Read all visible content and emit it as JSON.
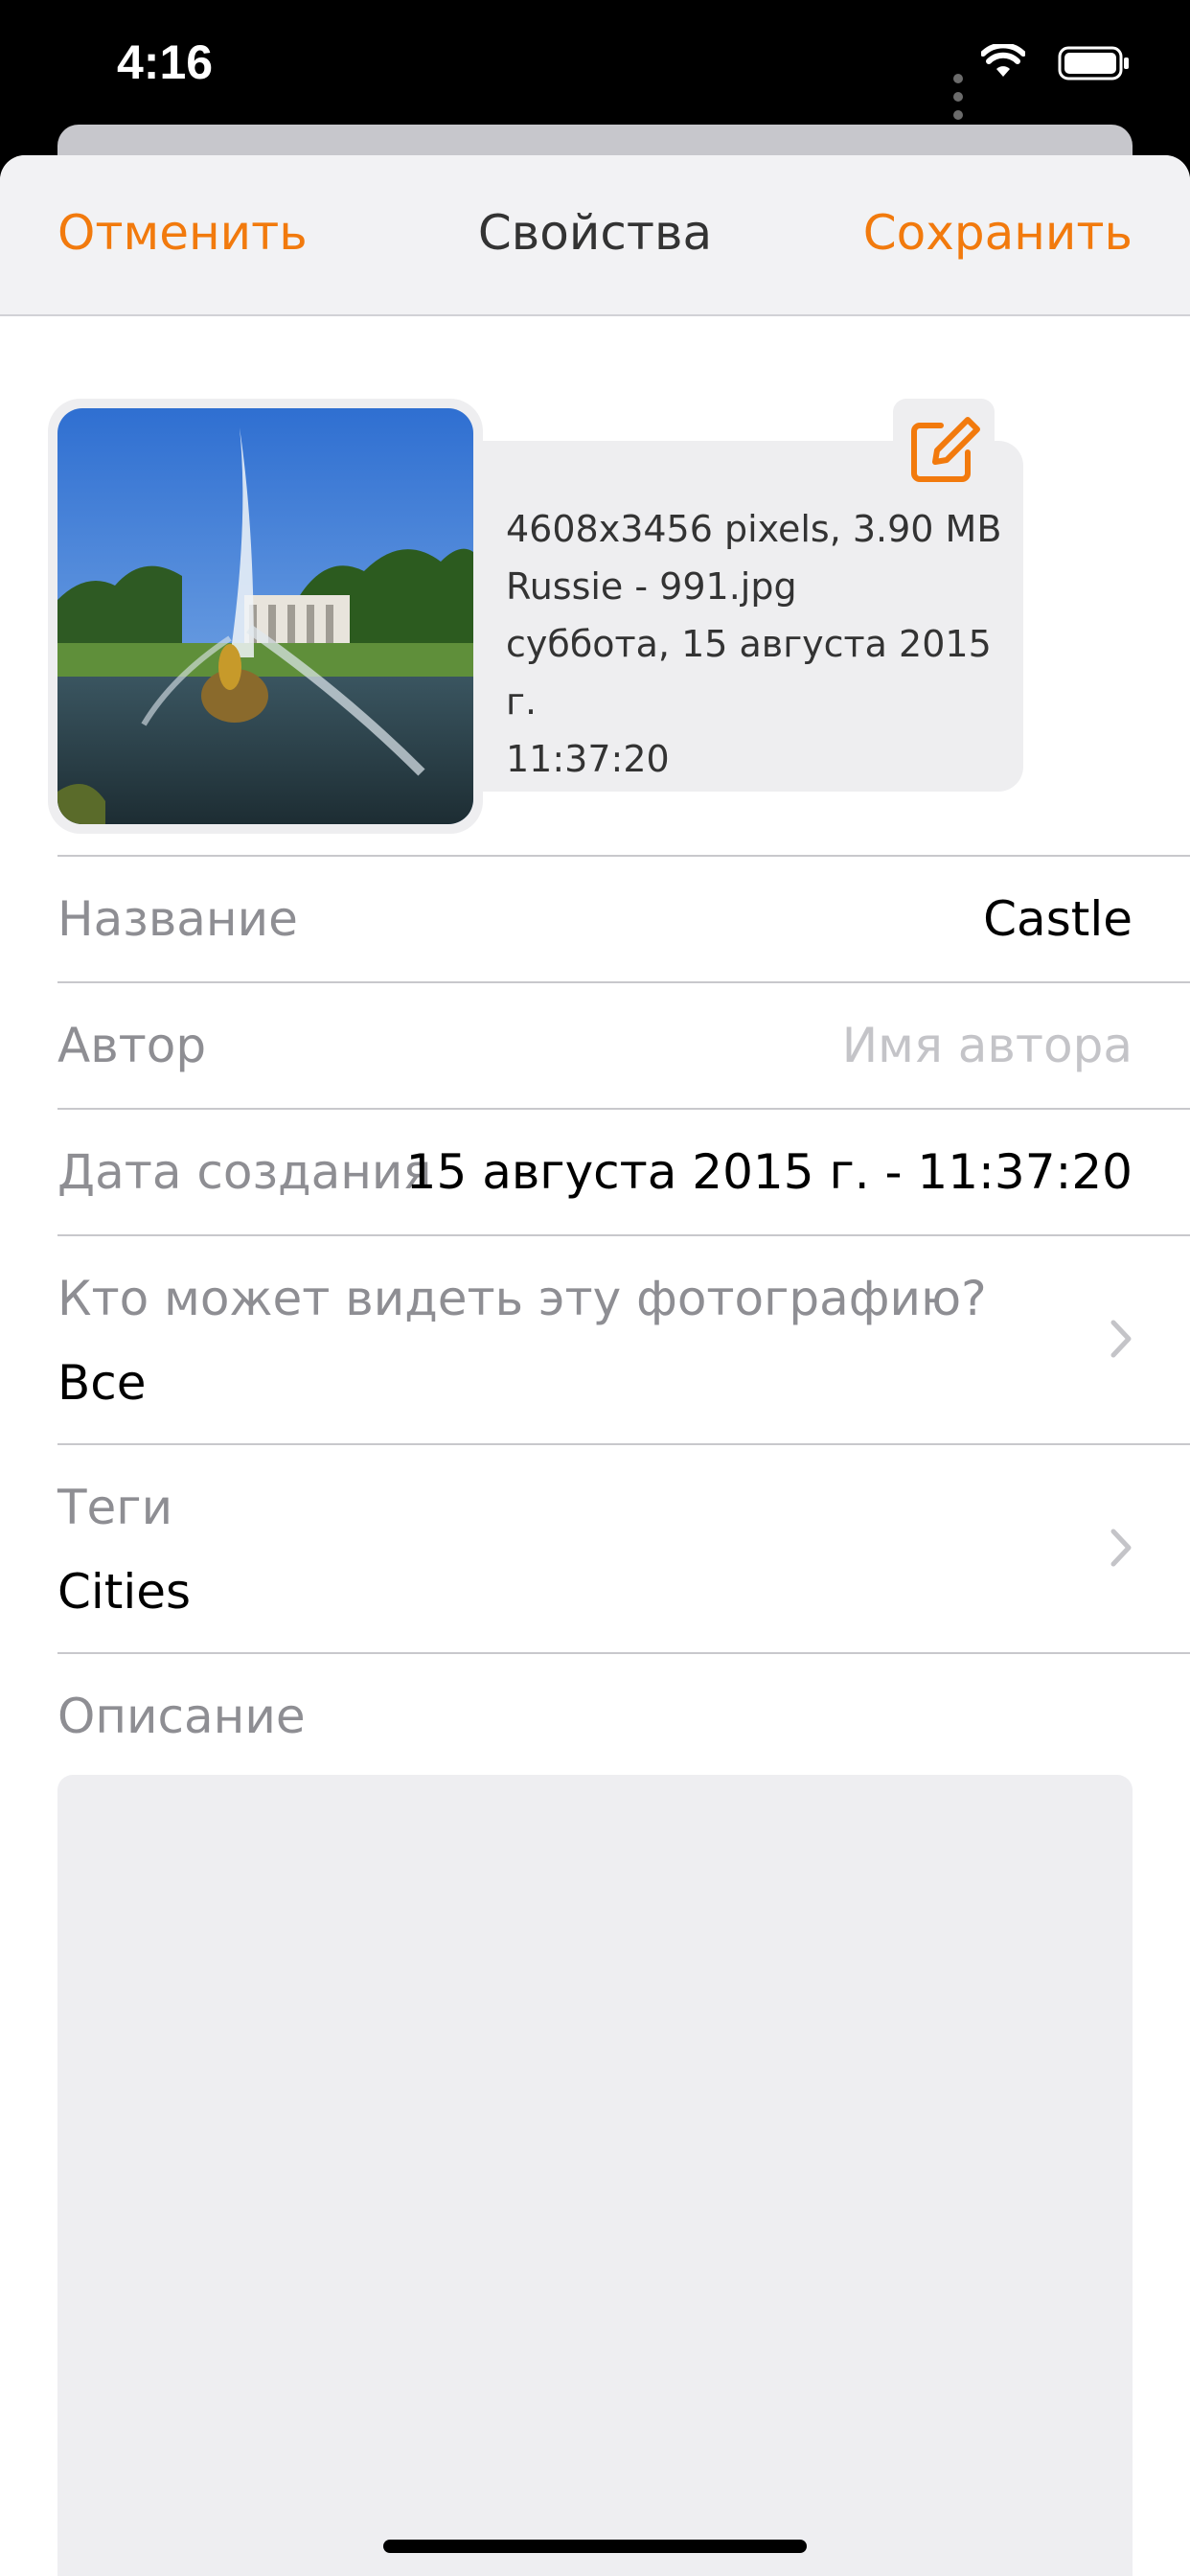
{
  "status_bar": {
    "time": "4:16",
    "icons": [
      "signal-dots-icon",
      "wifi-icon",
      "battery-icon"
    ]
  },
  "nav": {
    "cancel_label": "Отменить",
    "title": "Свойства",
    "save_label": "Сохранить",
    "accent_color": "#F27A0D"
  },
  "photo_info": {
    "dimensions_size": "4608x3456 pixels, 3.90 MB",
    "filename": "Russie - 991.jpg",
    "date_line": "суббота, 15 августа 2015 г.",
    "time_line": "11:37:20",
    "edit_icon": "edit-icon"
  },
  "fields": {
    "name": {
      "label": "Название",
      "value": "Castle"
    },
    "author": {
      "label": "Автор",
      "placeholder": "Имя автора"
    },
    "created": {
      "label": "Дата создания",
      "value": "15 августа 2015 г. - 11:37:20"
    },
    "visibility": {
      "label": "Кто может видеть эту фотографию?",
      "value": "Все"
    },
    "tags": {
      "label": "Теги",
      "value": "Cities"
    },
    "description": {
      "label": "Описание",
      "value": ""
    }
  }
}
